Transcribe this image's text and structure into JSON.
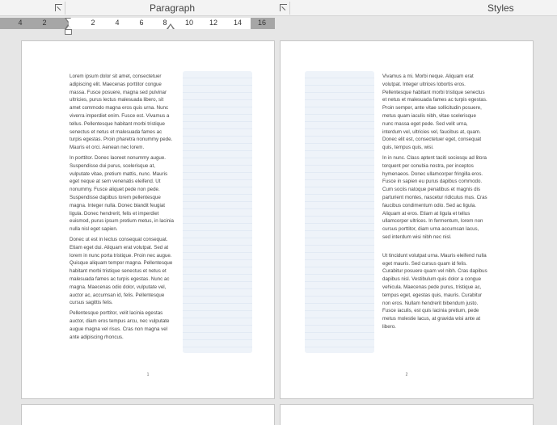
{
  "ribbon": {
    "group_paragraph": "Paragraph",
    "group_styles": "Styles"
  },
  "ruler": {
    "ticks": [
      "4",
      "2",
      "2",
      "4",
      "6",
      "8",
      "10",
      "12",
      "14",
      "16"
    ]
  },
  "pages": [
    {
      "paragraphs": [
        "Lorem ipsum dolor sit amet, consectetuer adipiscing elit. Maecenas porttitor congue massa. Fusce posuere, magna sed pulvinar ultricies, purus lectus malesuada libero, sit amet commodo magna eros quis urna. Nunc viverra imperdiet enim. Fusce est. Vivamus a tellus. Pellentesque habitant morbi tristique senectus et netus et malesuada fames ac turpis egestas. Proin pharetra nonummy pede. Mauris et orci. Aenean nec lorem.",
        "In porttitor. Donec laoreet nonummy augue. Suspendisse dui purus, scelerisque at, vulputate vitae, pretium mattis, nunc. Mauris eget neque at sem venenatis eleifend. Ut nonummy. Fusce aliquet pede non pede. Suspendisse dapibus lorem pellentesque magna. Integer nulla. Donec blandit feugiat ligula. Donec hendrerit, felis et imperdiet euismod, purus ipsum pretium metus, in lacinia nulla nisl eget sapien.",
        "Donec ut est in lectus consequat consequat. Etiam eget dui. Aliquam erat volutpat. Sed at lorem in nunc porta tristique. Proin nec augue. Quisque aliquam tempor magna. Pellentesque habitant morbi tristique senectus et netus et malesuada fames ac turpis egestas. Nunc ac magna. Maecenas odio dolor, vulputate vel, auctor ac, accumsan id, felis. Pellentesque cursus sagittis felis.",
        "Pellentesque porttitor, velit lacinia egestas auctor, diam eros tempus arcu, nec vulputate augue magna vel risus. Cras non magna vel ante adipiscing rhoncus."
      ],
      "page_number": "1"
    },
    {
      "paragraphs": [
        "Vivamus a mi. Morbi neque. Aliquam erat volutpat. Integer ultrices lobortis eros. Pellentesque habitant morbi tristique senectus et netus et malesuada fames ac turpis egestas. Proin semper, ante vitae sollicitudin posuere, metus quam iaculis nibh, vitae scelerisque nunc massa eget pede. Sed velit urna, interdum vel, ultricies vel, faucibus at, quam. Donec elit est, consectetuer eget, consequat quis, tempus quis, wisi.",
        "In in nunc. Class aptent taciti sociosqu ad litora torquent per conubia nostra, per inceptos hymenaeos. Donec ullamcorper fringilla eros. Fusce in sapien eu purus dapibus commodo. Cum sociis natoque penatibus et magnis dis parturient montes, nascetur ridiculus mus. Cras faucibus condimentum odio. Sed ac ligula. Aliquam at eros. Etiam at ligula et tellus ullamcorper ultrices. In fermentum, lorem non cursus porttitor, diam urna accumsan lacus, sed interdum wisi nibh nec nisl.",
        "Ut tincidunt volutpat urna. Mauris eleifend nulla eget mauris. Sed cursus quam id felis. Curabitur posuere quam vel nibh. Cras dapibus dapibus nisl. Vestibulum quis dolor a congue vehicula. Maecenas pede purus, tristique ac, tempus eget, egestas quis, mauris. Curabitur non eros. Nullam hendrerit bibendum justo. Fusce iaculis, est quis lacinia pretium, pede metus molestie lacus, at gravida wisi ante at libero."
      ],
      "page_number": "2"
    }
  ]
}
